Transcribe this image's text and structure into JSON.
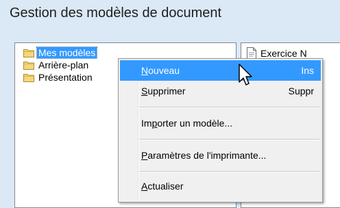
{
  "dialog": {
    "title": "Gestion des modèles de document"
  },
  "tree": {
    "items": [
      {
        "label": "Mes modèles",
        "selected": true
      },
      {
        "label": "Arrière-plan",
        "selected": false
      },
      {
        "label": "Présentation",
        "selected": false
      }
    ]
  },
  "documents": {
    "items": [
      {
        "label": "Exercice N"
      }
    ]
  },
  "context_menu": {
    "items": [
      {
        "mnemonic": "N",
        "rest": "ouveau",
        "shortcut": "Ins",
        "highlighted": true
      },
      {
        "mnemonic": "S",
        "rest": "upprimer",
        "shortcut": "Suppr",
        "highlighted": false
      },
      {
        "pre": "Im",
        "mnemonic": "p",
        "rest": "orter un modèle...",
        "shortcut": ""
      },
      {
        "mnemonic": "P",
        "rest": "aramètres de l'imprimante...",
        "shortcut": ""
      },
      {
        "mnemonic": "A",
        "rest": "ctualiser",
        "shortcut": ""
      }
    ]
  },
  "colors": {
    "background": "#dbe8f6",
    "selection": "#3399ff",
    "folder": "#f5d77a"
  },
  "icons": [
    "folder-icon",
    "document-icon",
    "mouse-cursor-icon"
  ]
}
